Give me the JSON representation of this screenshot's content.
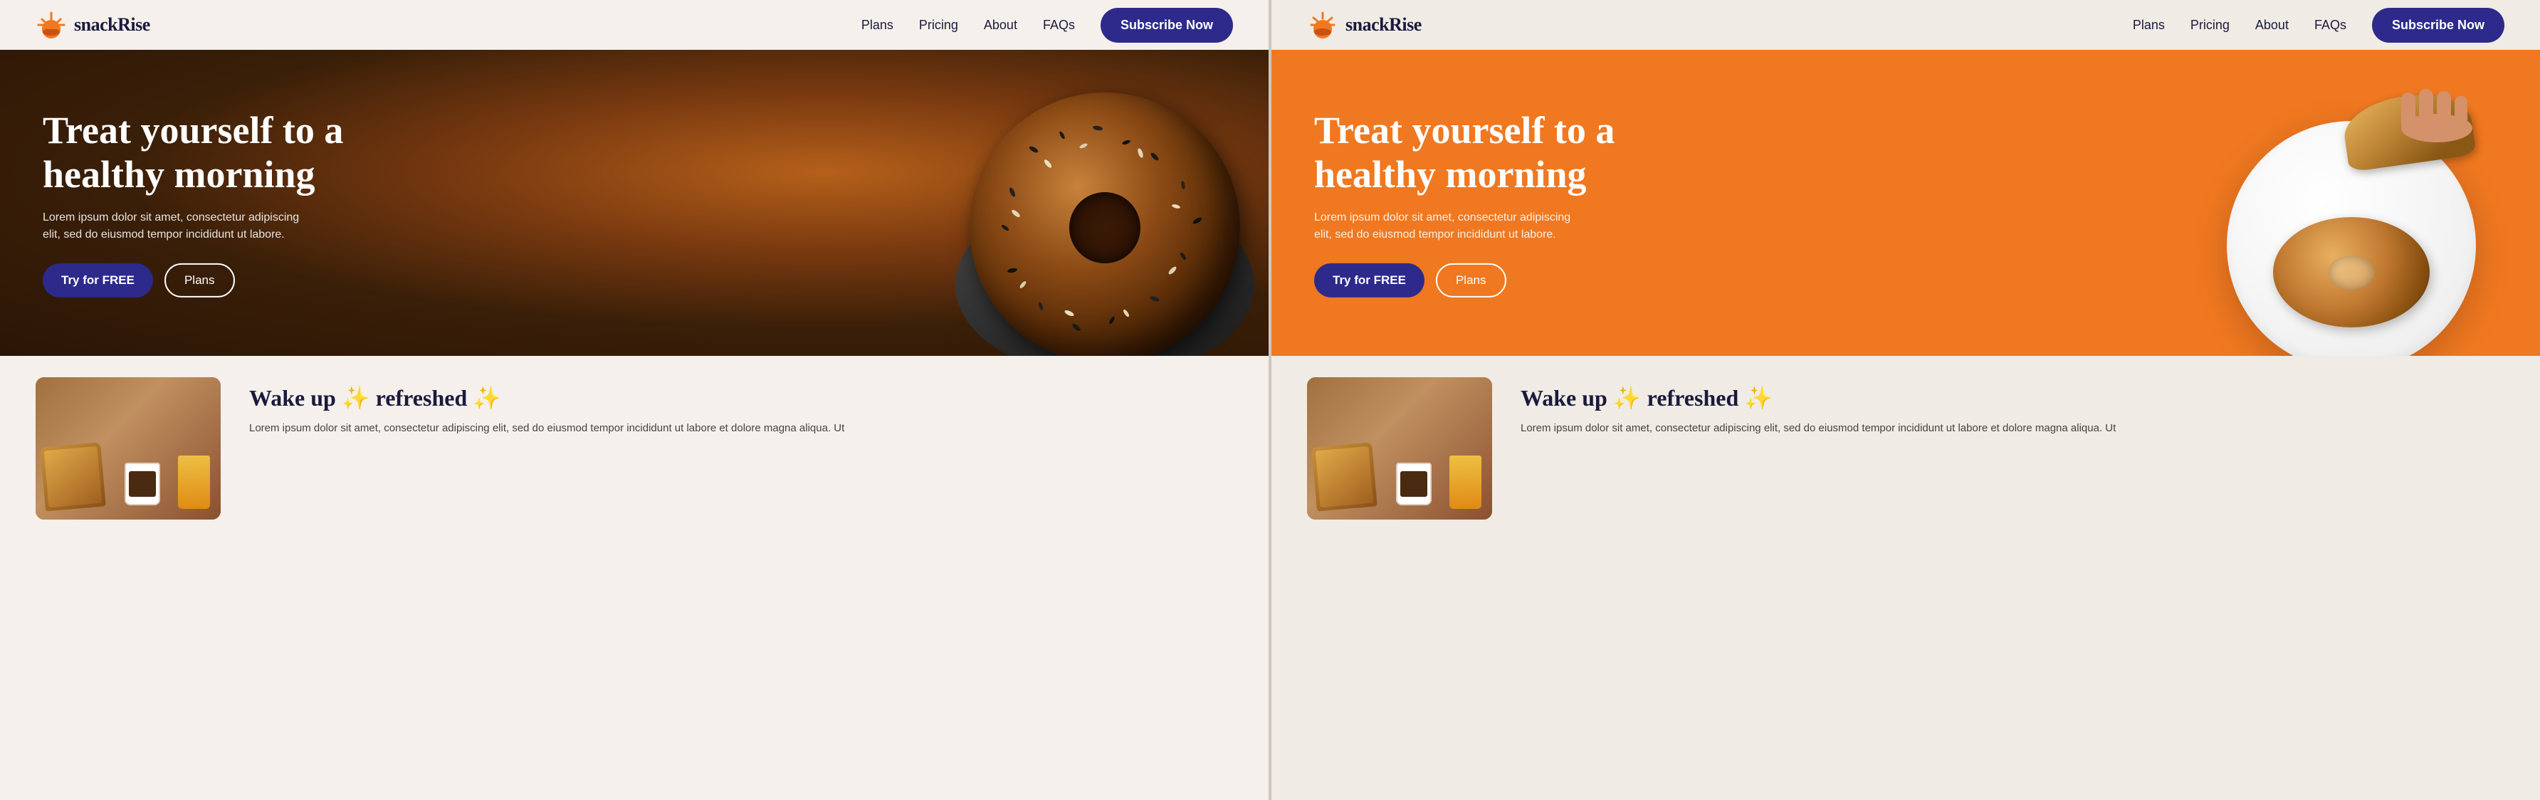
{
  "leftPanel": {
    "navbar": {
      "logoText": "snackRise",
      "links": [
        {
          "label": "Plans",
          "id": "plans"
        },
        {
          "label": "Pricing",
          "id": "pricing"
        },
        {
          "label": "About",
          "id": "about"
        },
        {
          "label": "FAQs",
          "id": "faqs"
        }
      ],
      "subscribeLabel": "Subscribe Now"
    },
    "hero": {
      "title": "Treat yourself to a healthy morning",
      "subtitle": "Lorem ipsum dolor sit amet, consectetur adipiscing elit, sed do eiusmod tempor incididunt ut labore.",
      "tryLabel": "Try for FREE",
      "plansLabel": "Plans"
    },
    "lower": {
      "title": "Wake up",
      "sparkle1": "✨",
      "refreshed": "refreshed",
      "sparkle2": "✨",
      "description": "Lorem ipsum dolor sit amet, consectetur adipiscing elit, sed do eiusmod tempor incididunt ut labore et dolore magna aliqua. Ut"
    }
  },
  "rightPanel": {
    "navbar": {
      "logoText": "snackRise",
      "links": [
        {
          "label": "Plans",
          "id": "plans"
        },
        {
          "label": "Pricing",
          "id": "pricing"
        },
        {
          "label": "About",
          "id": "about"
        },
        {
          "label": "FAQs",
          "id": "faqs"
        }
      ],
      "subscribeLabel": "Subscribe Now"
    },
    "hero": {
      "title": "Treat yourself to a healthy morning",
      "subtitle": "Lorem ipsum dolor sit amet, consectetur adipiscing elit, sed do eiusmod tempor incididunt ut labore.",
      "tryLabel": "Try for FREE",
      "plansLabel": "Plans"
    },
    "lower": {
      "title": "Wake up",
      "sparkle1": "✨",
      "refreshed": "refreshed",
      "sparkle2": "✨",
      "description": "Lorem ipsum dolor sit amet, consectetur adipiscing elit, sed do eiusmod tempor incididunt ut labore et dolore magna aliqua. Ut"
    }
  }
}
